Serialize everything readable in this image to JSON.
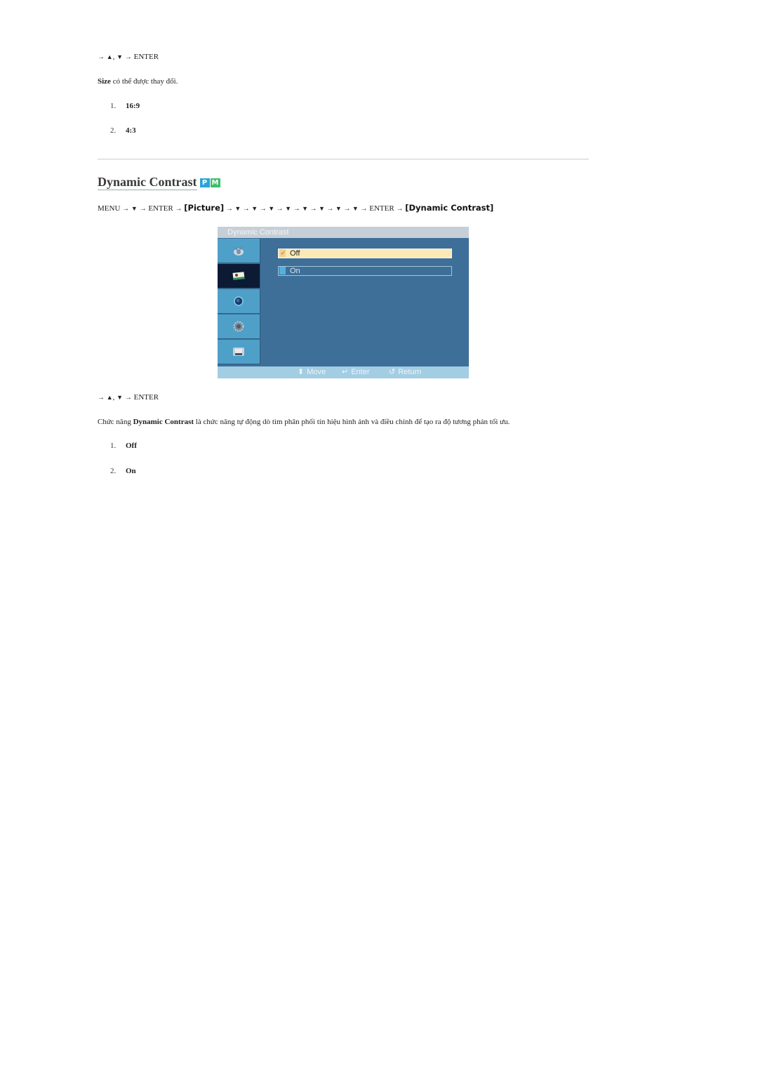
{
  "section_prev": {
    "nav_line": {
      "arrow1": "→",
      "up": "▲",
      "sep": ",",
      "down": "▼",
      "arrow2": "→",
      "enter": "ENTER"
    },
    "description": {
      "bold": "Size",
      "rest": " có thể được thay đổi."
    },
    "options": [
      {
        "num": "1.",
        "label": "16:9"
      },
      {
        "num": "2.",
        "label": "4:3"
      }
    ]
  },
  "section": {
    "title": "Dynamic Contrast",
    "badges": [
      "P",
      "M"
    ],
    "menu_path": {
      "start": "MENU",
      "arrow": "→",
      "down": "▼",
      "enter": "ENTER",
      "picture": "[Picture]",
      "down_count_after_picture": 8,
      "target": "[Dynamic Contrast]"
    },
    "osd": {
      "title": "Dynamic Contrast",
      "sidebar_icons": [
        "input-icon",
        "picture-icon",
        "sound-icon",
        "setup-icon",
        "multi-control-icon"
      ],
      "active_sidebar_index": 1,
      "options": [
        {
          "label": "Off",
          "selected": true,
          "check": "✓"
        },
        {
          "label": "On",
          "selected": false
        }
      ],
      "footer": {
        "move": "Move",
        "enter": "Enter",
        "return": "Return"
      },
      "colors": {
        "panel": "#3e6f98",
        "title_bar": "#c6cfd8",
        "sidebar": "#4fa0c8",
        "sidebar_active": "#0c1a33",
        "selected_option": "#fde9b8",
        "footer": "#a3cde3"
      }
    },
    "nav_line": {
      "arrow1": "→",
      "up": "▲",
      "sep": ",",
      "down": "▼",
      "arrow2": "→",
      "enter": "ENTER"
    },
    "description": {
      "prefix": "Chức năng ",
      "bold": "Dynamic Contrast",
      "rest": " là chức năng tự động dò tìm phân phối tín hiệu hình ảnh và điều chỉnh để tạo ra độ tương phản tối ưu."
    },
    "options": [
      {
        "num": "1.",
        "label": "Off"
      },
      {
        "num": "2.",
        "label": "On"
      }
    ]
  }
}
